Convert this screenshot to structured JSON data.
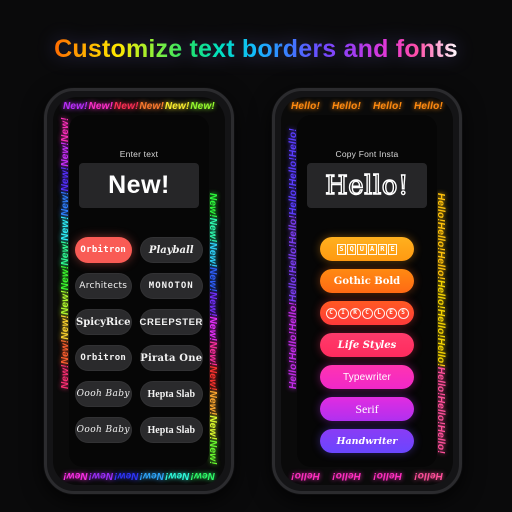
{
  "page": {
    "title": "Customize text borders and fonts",
    "background_color": "#0a0a0b",
    "title_gradient": [
      "#ff6a00",
      "#ffe800",
      "#23e06a",
      "#14b8ff",
      "#6d4bff",
      "#e038d8",
      "#ffffff"
    ]
  },
  "phone_left": {
    "name": "text-border-preview",
    "border_word": "New!",
    "border_repeat_top": 6,
    "border_repeat_side": 11,
    "field_label": "Enter text",
    "preview_value": "New!",
    "preview_placeholder": "Enter text",
    "font_chips": [
      {
        "label": "Orbitron",
        "style": "f-orbitron",
        "selected": true,
        "color": "#f95b55"
      },
      {
        "label": "Playball",
        "style": "f-playball",
        "selected": false,
        "color": "#2a2a2c"
      },
      {
        "label": "Architects",
        "style": "f-architects",
        "selected": false,
        "color": "#2a2a2c"
      },
      {
        "label": "MONOTON",
        "style": "f-monoton",
        "selected": false,
        "color": "#2a2a2c"
      },
      {
        "label": "SpicyRice",
        "style": "f-spicyrice",
        "selected": false,
        "color": "#2a2a2c"
      },
      {
        "label": "CREEPSTER",
        "style": "f-creepster",
        "selected": false,
        "color": "#2a2a2c"
      },
      {
        "label": "Orbitron",
        "style": "f-orbitron",
        "selected": false,
        "color": "#2a2a2c"
      },
      {
        "label": "Pirata One",
        "style": "f-pirata",
        "selected": false,
        "color": "#2a2a2c"
      },
      {
        "label": "Oooh Baby",
        "style": "f-oooh",
        "selected": false,
        "color": "#2a2a2c"
      },
      {
        "label": "Hepta Slab",
        "style": "f-hepta",
        "selected": false,
        "color": "#2a2a2c"
      },
      {
        "label": "Oooh Baby",
        "style": "f-oooh",
        "selected": false,
        "color": "#2a2a2c"
      },
      {
        "label": "Hepta Slab",
        "style": "f-hepta",
        "selected": false,
        "color": "#2a2a2c"
      }
    ]
  },
  "phone_right": {
    "name": "font-style-preview",
    "border_word": "Hello!",
    "border_repeat_top": 4,
    "border_repeat_side": 9,
    "field_label": "Copy Font Insta",
    "preview_value": "Hello!",
    "preview_placeholder": "Copy Font Insta",
    "style_pills": [
      {
        "label": "SQUARE",
        "style": "pill-sq",
        "boxed": "square",
        "color_from": "#ffb01e",
        "color_to": "#ff9a12"
      },
      {
        "label": "Gothic Bold",
        "style": "p-gothic",
        "boxed": "none",
        "color_from": "#ff8a12",
        "color_to": "#ff6a14"
      },
      {
        "label": "CIRCLES",
        "style": "pill-ci",
        "boxed": "circle",
        "color_from": "#ff5a22",
        "color_to": "#ff3a3a"
      },
      {
        "label": "Life Styles",
        "style": "p-life",
        "boxed": "none",
        "color_from": "#ff3b6b",
        "color_to": "#ff2b5e"
      },
      {
        "label": "Typewriter",
        "style": "p-type",
        "boxed": "none",
        "color_from": "#ff34b0",
        "color_to": "#f028c8"
      },
      {
        "label": "Serif",
        "style": "p-serif",
        "boxed": "none",
        "color_from": "#e22ce0",
        "color_to": "#b030f0"
      },
      {
        "label": "Handwriter",
        "style": "p-hand",
        "boxed": "none",
        "color_from": "#8a3cf5",
        "color_to": "#6a46ff"
      }
    ]
  }
}
